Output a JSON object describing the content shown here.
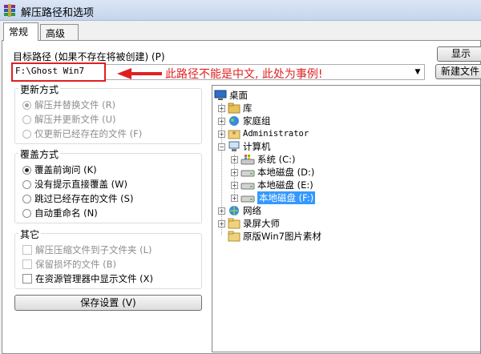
{
  "window": {
    "title": "解压路径和选项"
  },
  "tabs": [
    {
      "label": "常规"
    },
    {
      "label": "高级"
    }
  ],
  "path": {
    "label": "目标路径 (如果不存在将被创建) (P)",
    "value": "F:\\Ghost Win7",
    "annotation": "此路径不能是中文, 此处为事例!"
  },
  "buttons": {
    "display": "显示",
    "new_folder": "新建文件",
    "save_settings": "保存设置 (V)"
  },
  "update_mode": {
    "legend": "更新方式",
    "options": [
      {
        "label": "解压并替换文件 (R)",
        "checked": true
      },
      {
        "label": "解压并更新文件 (U)",
        "checked": false
      },
      {
        "label": "仅更新已经存在的文件 (F)",
        "checked": false
      }
    ]
  },
  "overwrite_mode": {
    "legend": "覆盖方式",
    "options": [
      {
        "label": "覆盖前询问 (K)",
        "checked": true
      },
      {
        "label": "没有提示直接覆盖 (W)",
        "checked": false
      },
      {
        "label": "跳过已经存在的文件 (S)",
        "checked": false
      },
      {
        "label": "自动重命名 (N)",
        "checked": false
      }
    ]
  },
  "misc": {
    "legend": "其它",
    "options": [
      {
        "label": "解压压缩文件到子文件夹 (L)",
        "checked": false
      },
      {
        "label": "保留损坏的文件 (B)",
        "checked": false
      },
      {
        "label": "在资源管理器中显示文件 (X)",
        "checked": false
      }
    ]
  },
  "tree": {
    "desktop": "桌面",
    "library": "库",
    "homegroup": "家庭组",
    "administrator": "Administrator",
    "computer": "计算机",
    "drive_c": "系统 (C:)",
    "drive_d": "本地磁盘 (D:)",
    "drive_e": "本地磁盘 (E:)",
    "drive_f": "本地磁盘 (F:)",
    "network": "网络",
    "recorder": "录屏大师",
    "images": "原版Win7图片素材"
  },
  "colors": {
    "accent_red": "#e02020",
    "selection": "#3399ff"
  }
}
